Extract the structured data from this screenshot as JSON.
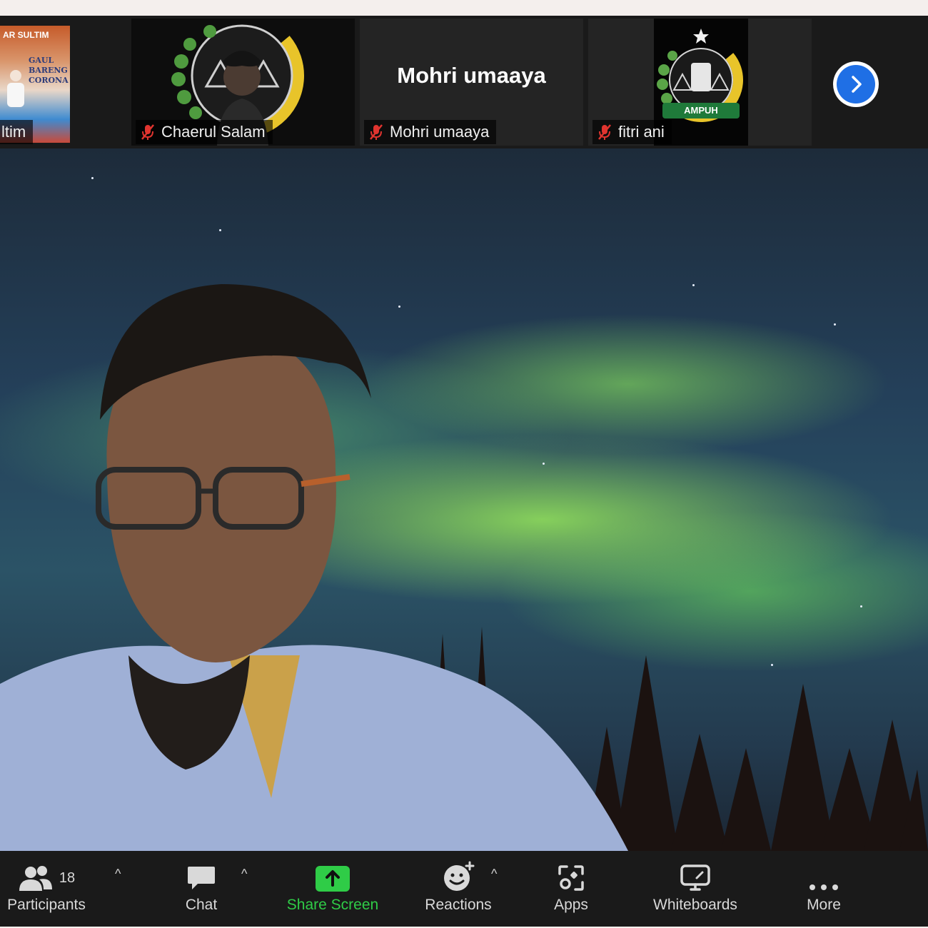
{
  "participants_strip": {
    "tiles": [
      {
        "name": "ltim",
        "poster_lines": [
          "AR SULTIM",
          "GAUL",
          "BARENG",
          "CORONA"
        ]
      },
      {
        "name": "Chaerul Salam"
      },
      {
        "name": "Mohri umaaya",
        "display_name": "Mohri umaaya"
      },
      {
        "name": "fitri ani",
        "badge_text": "AMPUH"
      }
    ],
    "next_icon": "chevron-right-icon"
  },
  "toolbar": {
    "participants_label": "Participants",
    "participants_count": "18",
    "chat_label": "Chat",
    "share_label": "Share Screen",
    "reactions_label": "Reactions",
    "apps_label": "Apps",
    "whiteboards_label": "Whiteboards",
    "more_label": "More"
  },
  "colors": {
    "share_accent": "#2fcc47",
    "next_button": "#1f6fe5",
    "mute_red": "#e0342f"
  }
}
